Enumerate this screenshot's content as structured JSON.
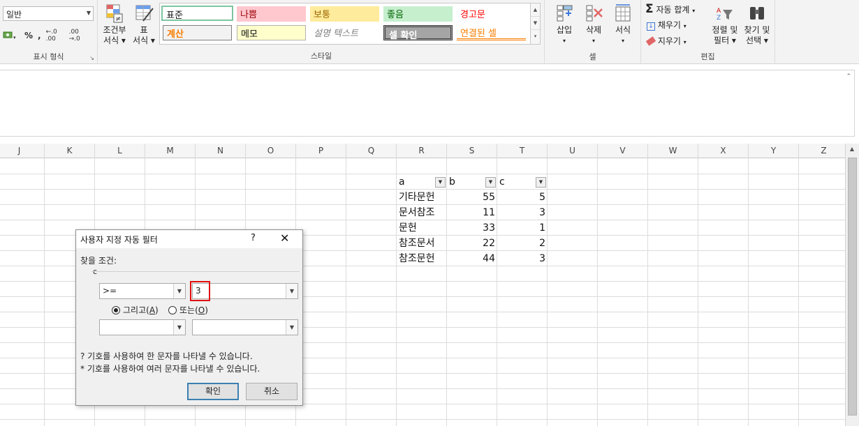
{
  "ribbon": {
    "number_format": {
      "value": "일반",
      "currency_icon": "currency-icon",
      "percent": "%",
      "comma": ",",
      "inc_decimal": "←.0 .00",
      "dec_decimal": ".00 →.0",
      "group_label": "표시 형식"
    },
    "cond_format": {
      "line1": "조건부",
      "line2": "서식 ▾"
    },
    "table_format": {
      "line1": "표",
      "line2": "서식 ▾"
    },
    "styles": {
      "cells": [
        {
          "label": "표준",
          "bg": "#ffffff",
          "fg": "#111111"
        },
        {
          "label": "나쁨",
          "bg": "#ffc7ce",
          "fg": "#9c0006"
        },
        {
          "label": "보통",
          "bg": "#ffeb9c",
          "fg": "#9c6500"
        },
        {
          "label": "좋음",
          "bg": "#c6efce",
          "fg": "#006100"
        },
        {
          "label": "경고문",
          "bg": "#ffffff",
          "fg": "#ff0000"
        },
        {
          "label": "계산",
          "bg": "#f2f2f2",
          "fg": "#fa7d00"
        },
        {
          "label": "메모",
          "bg": "#ffffcc",
          "fg": "#111111"
        },
        {
          "label": "설명 텍스트",
          "bg": "#ffffff",
          "fg": "#7f7f7f"
        },
        {
          "label": "셀 확인",
          "bg": "#a5a5a5",
          "fg": "#ffffff"
        },
        {
          "label": "연결된 셀",
          "bg": "#ffffff",
          "fg": "#fa7d00"
        }
      ],
      "group_label": "스타일"
    },
    "cells_group": {
      "insert": "삽입",
      "delete": "삭제",
      "format": "서식",
      "group_label": "셀"
    },
    "editing": {
      "autosum": "자동 합계",
      "fill": "채우기",
      "clear": "지우기",
      "sort_line1": "정렬 및",
      "sort_line2": "필터 ▾",
      "find_line1": "찾기 및",
      "find_line2": "선택 ▾",
      "group_label": "편집"
    }
  },
  "columns": [
    "J",
    "K",
    "L",
    "M",
    "N",
    "O",
    "P",
    "Q",
    "R",
    "S",
    "T",
    "U",
    "V",
    "W",
    "X",
    "Y",
    "Z"
  ],
  "table": {
    "headers": [
      "a",
      "b",
      "c"
    ],
    "rows": [
      [
        "기타문헌",
        "55",
        "5"
      ],
      [
        "문서참조",
        "11",
        "3"
      ],
      [
        "문헌",
        "33",
        "1"
      ],
      [
        "참조문서",
        "22",
        "2"
      ],
      [
        "참조문헌",
        "44",
        "3"
      ]
    ]
  },
  "dialog": {
    "title": "사용자 지정 자동 필터",
    "help": "?",
    "close": "✕",
    "find_label": "찾을 조건:",
    "field_name": "c",
    "op1": ">=",
    "val1": "3",
    "and_label": "그리고(",
    "and_key": "A",
    "and_close": ")",
    "or_label": "또는(",
    "or_key": "O",
    "or_close": ")",
    "op2": "",
    "val2": "",
    "hint1": "? 기호를 사용하여 한 문자를 나타낼 수 있습니다.",
    "hint2": "* 기호를 사용하여 여러 문자를 나타낼 수 있습니다.",
    "ok": "확인",
    "cancel": "취소"
  }
}
